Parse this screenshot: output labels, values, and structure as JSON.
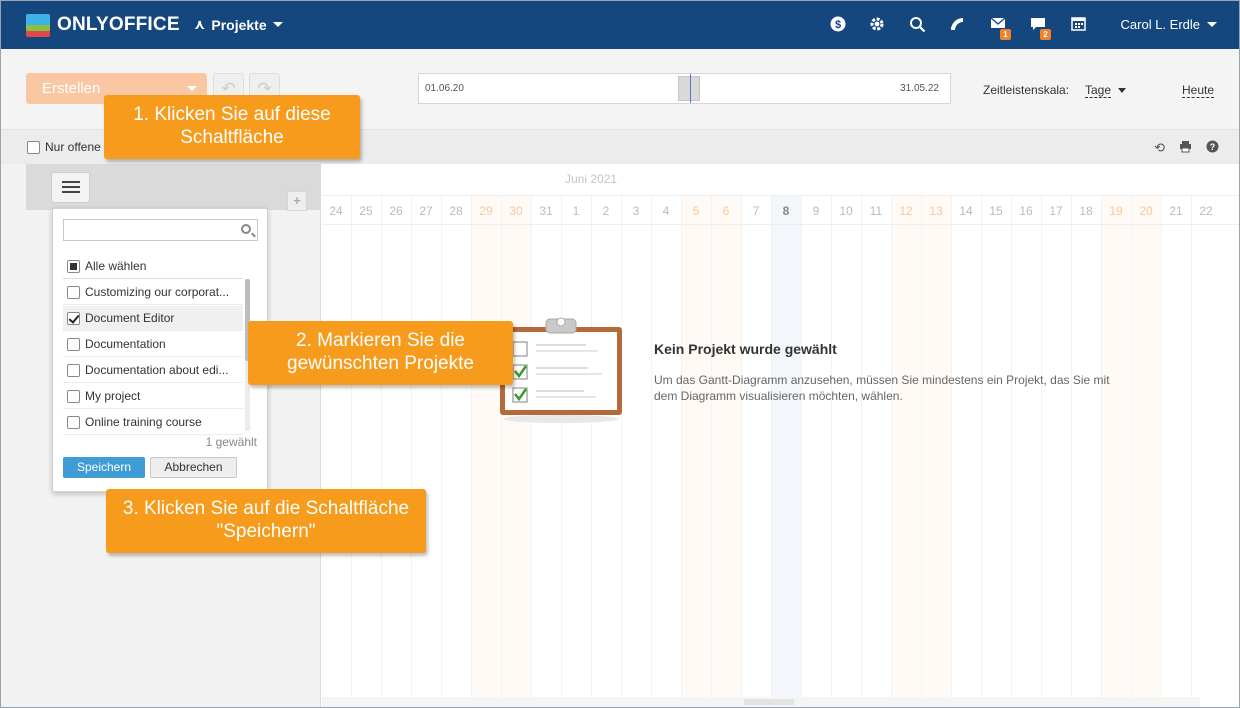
{
  "app": {
    "logo_text": "ONLYOFFICE",
    "module": "Projekte",
    "user": "Carol L. Erdle",
    "mail_badge": "1",
    "chat_badge": "2"
  },
  "toolbar": {
    "create_label": "Erstellen",
    "timeline_start": "01.06.20",
    "timeline_end": "31.05.22",
    "scale_label": "Zeitleistenskala:",
    "scale_value": "Tage",
    "today_label": "Heute"
  },
  "filter": {
    "only_open_label": "Nur offene"
  },
  "gantt": {
    "month_label": "Juni 2021",
    "days": [
      "24",
      "25",
      "26",
      "27",
      "28",
      "29",
      "30",
      "31",
      "1",
      "2",
      "3",
      "4",
      "5",
      "6",
      "7",
      "8",
      "9",
      "10",
      "11",
      "12",
      "13",
      "14",
      "15",
      "16",
      "17",
      "18",
      "19",
      "20",
      "21",
      "22"
    ],
    "weekend_indexes": [
      5,
      6,
      12,
      13,
      19,
      20,
      26,
      27
    ],
    "current_index": 15,
    "empty_title": "Kein Projekt wurde gewählt",
    "empty_text": "Um das Gantt-Diagramm anzusehen, müssen Sie mindestens ein Projekt, das Sie mit dem Diagramm visualisieren möchten, wählen."
  },
  "dropdown": {
    "select_all": "Alle wählen",
    "items": [
      {
        "label": "Customizing our corporat...",
        "checked": false
      },
      {
        "label": "Document Editor",
        "checked": true
      },
      {
        "label": "Documentation",
        "checked": false
      },
      {
        "label": "Documentation about edi...",
        "checked": false
      },
      {
        "label": "My project",
        "checked": false
      },
      {
        "label": "Online training course",
        "checked": false
      }
    ],
    "count_label": "1 gewählt",
    "save_label": "Speichern",
    "cancel_label": "Abbrechen"
  },
  "callouts": {
    "step1": "1. Klicken Sie auf diese Schaltfläche",
    "step2": "2. Markieren Sie die gewünschten Projekte",
    "step3": "3. Klicken Sie auf die Schaltfläche \"Speichern\""
  },
  "colors": {
    "header_bg": "#15477f",
    "accent_orange": "#f79b1c",
    "save_blue": "#3f9cd5"
  }
}
